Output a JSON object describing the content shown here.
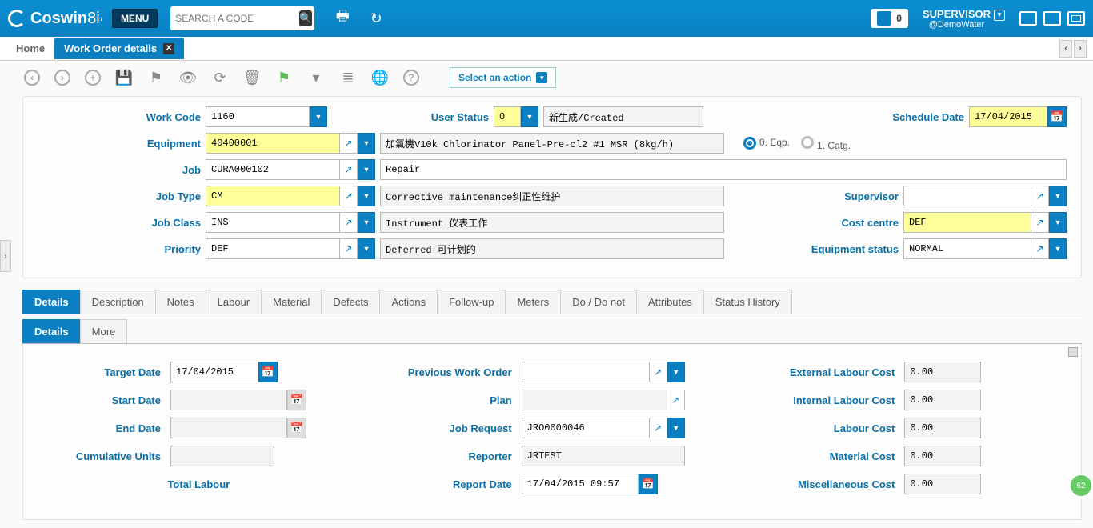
{
  "app": {
    "name": "Coswin",
    "version": "8i",
    "menu": "MENU"
  },
  "search": {
    "placeholder": "SEARCH A CODE"
  },
  "notifications": {
    "count": "0"
  },
  "user": {
    "name": "SUPERVISOR",
    "context": "@DemoWater"
  },
  "tabs": {
    "home": "Home",
    "current": "Work Order details"
  },
  "action_select": "Select an action",
  "header": {
    "work_code": {
      "label": "Work Code",
      "value": "1160"
    },
    "user_status": {
      "label": "User Status",
      "code": "0",
      "desc": "新生成/Created"
    },
    "schedule_date": {
      "label": "Schedule Date",
      "value": "17/04/2015"
    },
    "equipment": {
      "label": "Equipment",
      "code": "40400001",
      "desc": "加氯機V10k Chlorinator Panel-Pre-cl2 #1 MSR (8kg/h)"
    },
    "radio": {
      "eqp": "0. Eqp.",
      "catg": "1. Catg."
    },
    "job": {
      "label": "Job",
      "code": "CURA000102",
      "desc": "Repair"
    },
    "job_type": {
      "label": "Job Type",
      "code": "CM",
      "desc": "Corrective maintenance纠正性维护"
    },
    "supervisor": {
      "label": "Supervisor",
      "value": ""
    },
    "job_class": {
      "label": "Job Class",
      "code": "INS",
      "desc": "Instrument 仪表工作"
    },
    "cost_centre": {
      "label": "Cost centre",
      "value": "DEF"
    },
    "priority": {
      "label": "Priority",
      "code": "DEF",
      "desc": "Deferred 可计划的"
    },
    "equipment_status": {
      "label": "Equipment status",
      "value": "NORMAL"
    }
  },
  "subtabs": [
    "Details",
    "Description",
    "Notes",
    "Labour",
    "Material",
    "Defects",
    "Actions",
    "Follow-up",
    "Meters",
    "Do / Do not",
    "Attributes",
    "Status History"
  ],
  "subtabs2": [
    "Details",
    "More"
  ],
  "details": {
    "target_date": {
      "label": "Target Date",
      "value": "17/04/2015"
    },
    "start_date": {
      "label": "Start Date",
      "value": ""
    },
    "end_date": {
      "label": "End Date",
      "value": ""
    },
    "cumulative_units": {
      "label": "Cumulative Units",
      "value": ""
    },
    "total_labour": {
      "label": "Total Labour"
    },
    "previous_wo": {
      "label": "Previous Work Order",
      "value": ""
    },
    "plan": {
      "label": "Plan",
      "value": ""
    },
    "job_request": {
      "label": "Job Request",
      "value": "JRO0000046"
    },
    "reporter": {
      "label": "Reporter",
      "value": "JRTEST"
    },
    "report_date": {
      "label": "Report Date",
      "value": "17/04/2015 09:57"
    },
    "ext_labour_cost": {
      "label": "External Labour Cost",
      "value": "0.00"
    },
    "int_labour_cost": {
      "label": "Internal Labour Cost",
      "value": "0.00"
    },
    "labour_cost": {
      "label": "Labour Cost",
      "value": "0.00"
    },
    "material_cost": {
      "label": "Material Cost",
      "value": "0.00"
    },
    "misc_cost": {
      "label": "Miscellaneous Cost",
      "value": "0.00"
    }
  }
}
